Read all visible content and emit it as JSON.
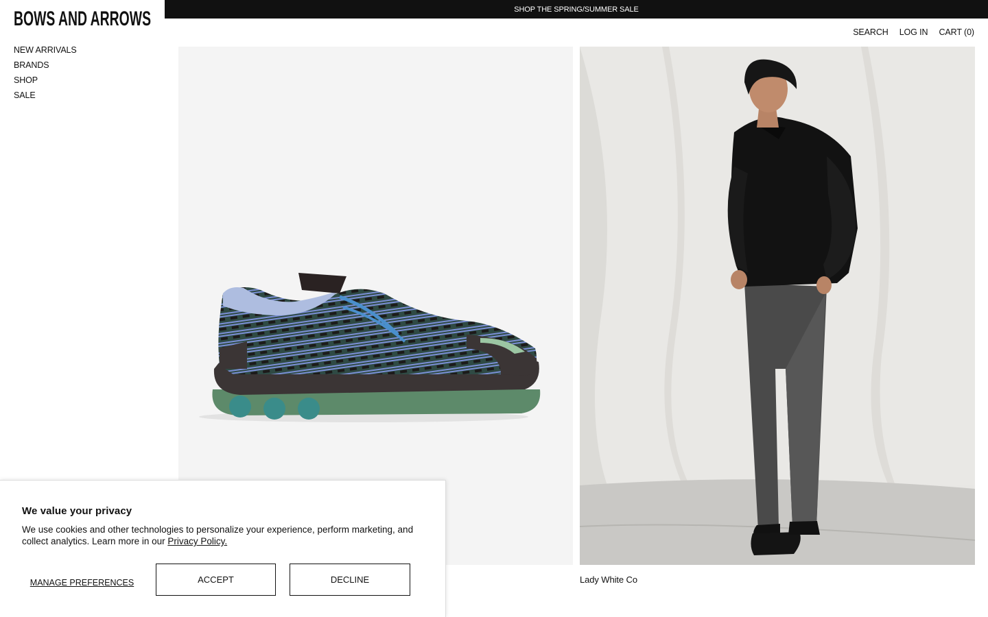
{
  "announcement": "SHOP THE SPRING/SUMMER SALE",
  "brand": "BOWS AND ARROWS",
  "nav": [
    {
      "label": "NEW ARRIVALS"
    },
    {
      "label": "BRANDS"
    },
    {
      "label": "SHOP"
    },
    {
      "label": "SALE"
    }
  ],
  "header": {
    "search": "SEARCH",
    "login": "LOG IN",
    "cart": "CART (0)"
  },
  "tiles": [
    {
      "caption": "",
      "image": "sneaker-photo"
    },
    {
      "caption": "Lady White Co",
      "image": "model-photo"
    }
  ],
  "privacy": {
    "title": "We value your privacy",
    "body": "We use cookies and other technologies to personalize your experience, perform marketing, and collect analytics. Learn more in our ",
    "link": "Privacy Policy.",
    "manage": "MANAGE PREFERENCES",
    "accept": "ACCEPT",
    "decline": "DECLINE"
  },
  "colors": {
    "announcement_bg": "#111111",
    "tile_left_bg": "#f4f4f4",
    "tile_right_bg": "#e8e7e4"
  }
}
